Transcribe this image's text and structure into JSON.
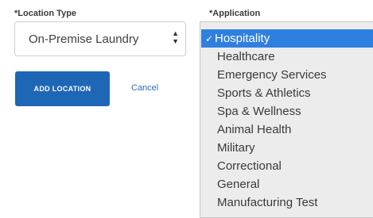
{
  "form": {
    "location_type": {
      "label": "*Location Type",
      "value": "On-Premise Laundry",
      "icon": "chevron-up-down-icon"
    },
    "application": {
      "label": "*Application",
      "selected": "Hospitality",
      "check_mark": "✓",
      "options": [
        "Hospitality",
        "Healthcare",
        "Emergency Services",
        "Sports & Athletics",
        "Spa & Wellness",
        "Animal Health",
        "Military",
        "Correctional",
        "General",
        "Manufacturing Test"
      ]
    },
    "buttons": {
      "add_location": "ADD LOCATION",
      "cancel": "Cancel"
    }
  },
  "colors": {
    "primary_button": "#1e66b6",
    "link": "#2a6ebb",
    "selected_option": "#2f7fe0",
    "dropdown_background": "#ececec"
  }
}
